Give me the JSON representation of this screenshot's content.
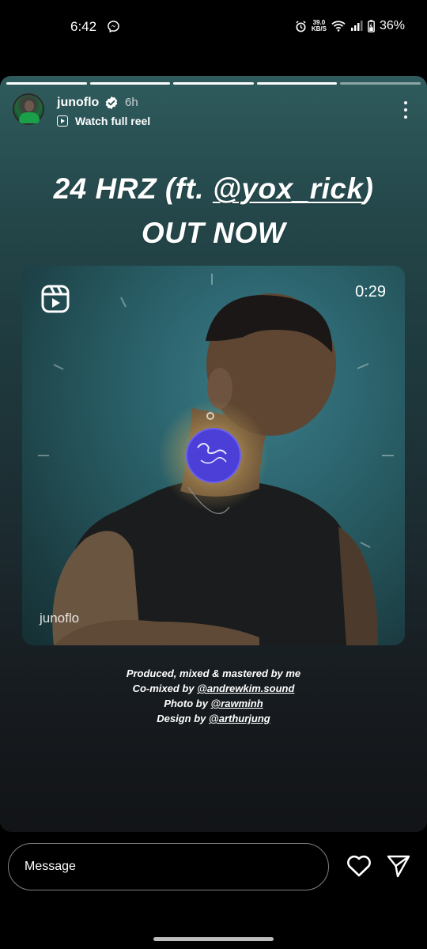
{
  "status_bar": {
    "time": "6:42",
    "net_speed_value": "39.0",
    "net_speed_unit": "KB/S",
    "battery": "36%",
    "icons": [
      "messenger-icon",
      "alarm-icon",
      "wifi-icon",
      "signal-icon",
      "battery-icon"
    ]
  },
  "story": {
    "progress_segments": 5,
    "progress_done": 4,
    "username": "junoflo",
    "verified": true,
    "posted_ago": "6h",
    "watch_link": "Watch full reel",
    "headline_part1": "24 HRZ (ft. ",
    "headline_mention": "@yox_rick",
    "headline_part2": ")",
    "headline_line2": "OUT NOW",
    "reel": {
      "duration": "0:29",
      "watermark": "junoflo"
    },
    "credits": {
      "line1": "Produced, mixed & mastered by me",
      "line2_prefix": "Co-mixed by ",
      "line2_mention": "@andrewkim.sound",
      "line3_prefix": "Photo by ",
      "line3_mention": "@rawminh",
      "line4_prefix": "Design by ",
      "line4_mention": "@arthurjung"
    }
  },
  "bottom_bar": {
    "message_placeholder": "Message"
  },
  "colors": {
    "background": "#000000",
    "story_top": "#2f5b5d",
    "story_bottom": "#121417",
    "sticker": "#4b3fd8"
  }
}
